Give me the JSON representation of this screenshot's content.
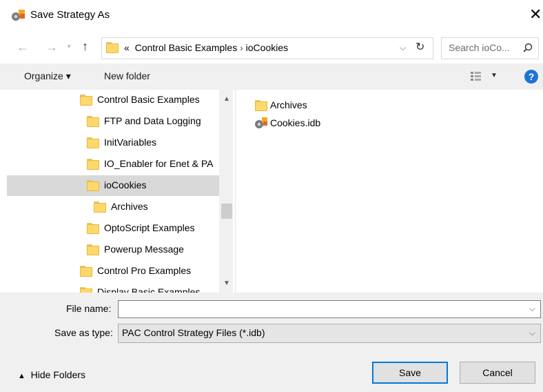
{
  "window": {
    "title": "Save Strategy As",
    "close_glyph": "✕"
  },
  "nav": {
    "back_icon": "arrow-left-icon",
    "forward_icon": "arrow-right-icon",
    "up_icon": "arrow-up-icon",
    "breadcrumb_prefix": "«",
    "breadcrumb": [
      "Control Basic Examples",
      "ioCookies"
    ],
    "breadcrumb_sep": "›",
    "search_placeholder": "Search ioCo..."
  },
  "toolbar": {
    "organize_label": "Organize ▾",
    "new_folder_label": "New folder",
    "help_label": "?"
  },
  "tree": [
    {
      "label": "Control Basic Examples",
      "selected": false
    },
    {
      "label": "FTP and Data Logging",
      "selected": false
    },
    {
      "label": "InitVariables",
      "selected": false
    },
    {
      "label": "IO_Enabler for Enet & PA",
      "selected": false
    },
    {
      "label": "ioCookies",
      "selected": true
    },
    {
      "label": "Archives",
      "selected": false
    },
    {
      "label": "OptoScript Examples",
      "selected": false
    },
    {
      "label": "Powerup Message",
      "selected": false
    },
    {
      "label": "Control Pro Examples",
      "selected": false
    },
    {
      "label": "Display Basic Examples",
      "selected": false
    }
  ],
  "files": [
    {
      "label": "Archives",
      "icon": "folder-icon"
    },
    {
      "label": "Cookies.idb",
      "icon": "strategy-file-icon"
    }
  ],
  "form": {
    "file_name_label": "File name:",
    "file_name_value": "",
    "save_type_label": "Save as type:",
    "save_type_value": "PAC Control Strategy Files (*.idb)"
  },
  "buttons": {
    "save": "Save",
    "cancel": "Cancel",
    "hide_folders": "Hide Folders"
  },
  "colors": {
    "accent": "#0078d7",
    "selection": "#d9d9d9",
    "folder": "#ffd86b"
  }
}
